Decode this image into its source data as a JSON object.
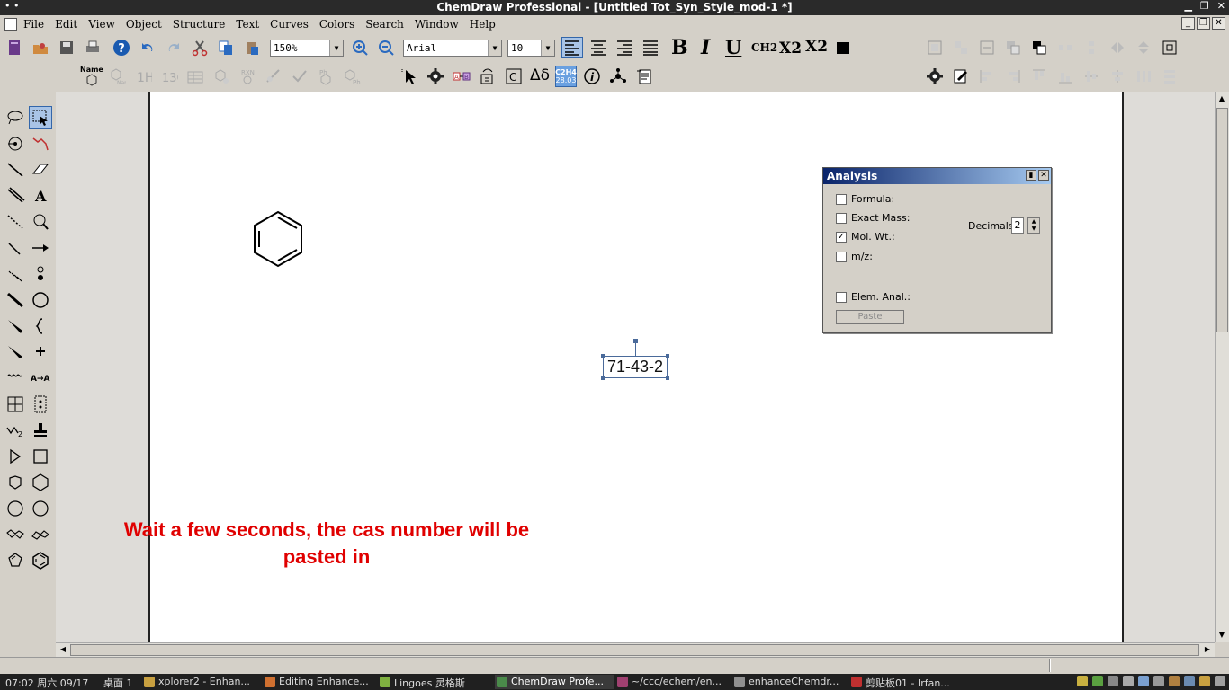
{
  "window": {
    "title": "ChemDraw Professional - [Untitled Tot_Syn_Style_mod-1 *]",
    "left_glyphs": "• •"
  },
  "menu": {
    "items": [
      "File",
      "Edit",
      "View",
      "Object",
      "Structure",
      "Text",
      "Curves",
      "Colors",
      "Search",
      "Window",
      "Help"
    ]
  },
  "toolbar": {
    "zoom": "150%",
    "font": "Arial",
    "font_size": "10",
    "bold": "B",
    "italic": "I",
    "underline": "U",
    "formula_style": "CH2",
    "subscript": "X2",
    "superscript": "X2",
    "name_label": "Name",
    "c2h4_label": "C2H4",
    "c2h4_mass": "28.03",
    "delta": "Δδ",
    "info": "i"
  },
  "analysis": {
    "title": "Analysis",
    "rows": [
      {
        "label": "Formula:",
        "checked": false
      },
      {
        "label": "Exact Mass:",
        "checked": false
      },
      {
        "label": "Mol. Wt.:",
        "checked": true
      },
      {
        "label": "m/z:",
        "checked": false
      },
      {
        "label": "Elem. Anal.:",
        "checked": false
      }
    ],
    "decimals_label": "Decimals:",
    "decimals_value": "2",
    "paste_label": "Paste",
    "check_mark": "✓"
  },
  "canvas": {
    "cas_number": "71-43-2",
    "instruction": "Wait a few seconds, the cas number will be pasted in"
  },
  "taskbar": {
    "clock": "07:02 周六 09/17",
    "desktop": "桌面 1",
    "tasks": [
      {
        "label": "xplorer2 - Enhan...",
        "color": "#c8a040"
      },
      {
        "label": "Editing Enhance...",
        "color": "#d07030"
      },
      {
        "label": "Lingoes 灵格斯",
        "color": "#7fb040"
      },
      {
        "label": "ChemDraw Profe...",
        "color": "#4a8a4a",
        "active": true
      },
      {
        "label": "~/ccc/echem/en...",
        "color": "#a04070"
      },
      {
        "label": "enhanceChemdr...",
        "color": "#909090"
      },
      {
        "label": "剪贴板01 - Irfan...",
        "color": "#c03030"
      }
    ]
  }
}
